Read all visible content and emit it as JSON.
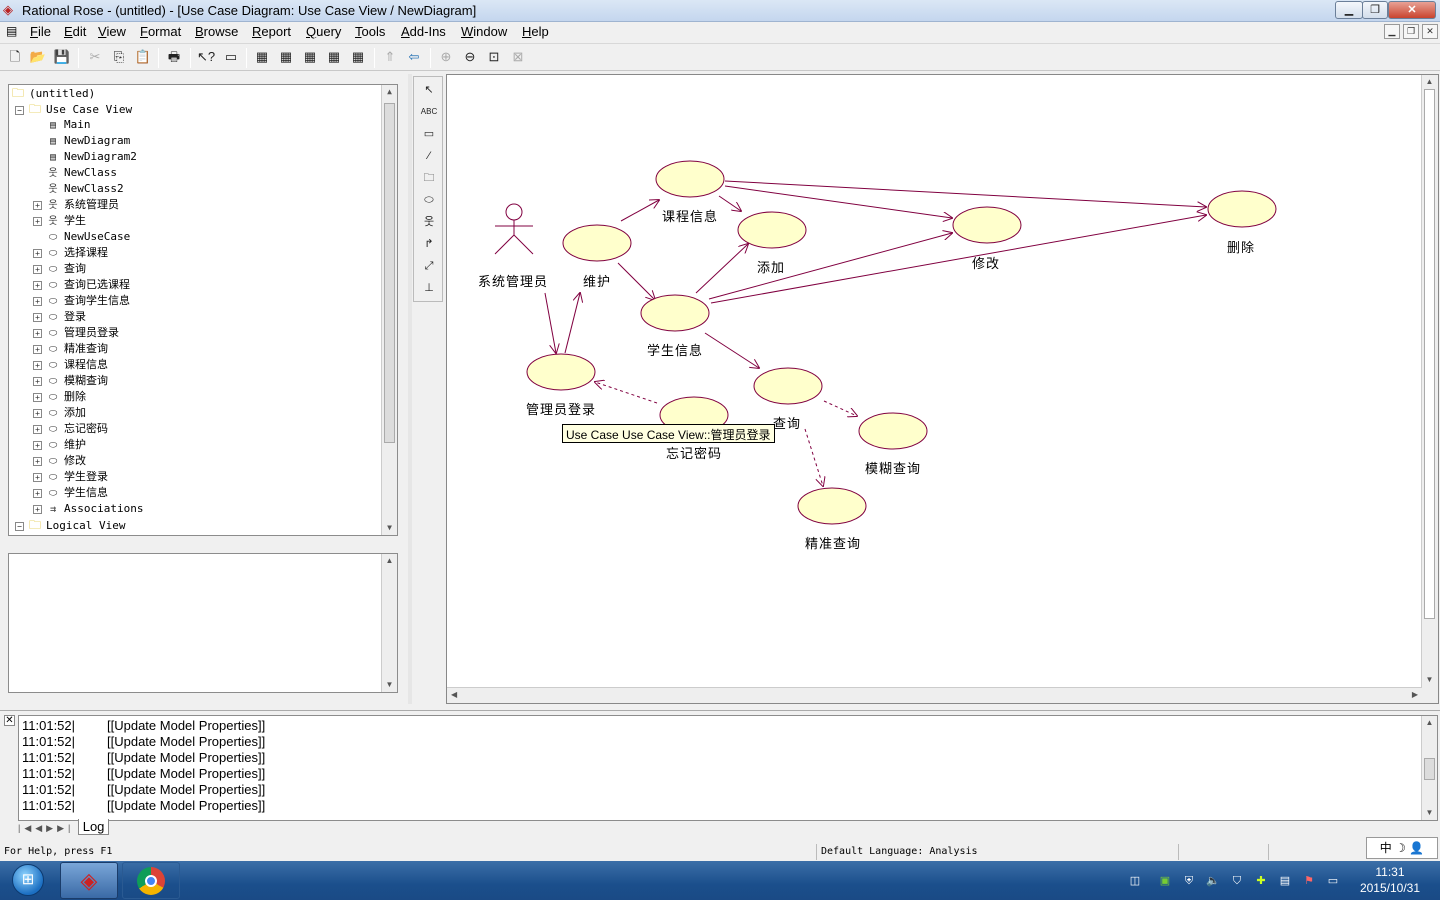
{
  "window": {
    "title": "Rational Rose - (untitled) - [Use Case Diagram: Use Case View / NewDiagram]"
  },
  "menu": [
    {
      "key": "F",
      "rest": "ile"
    },
    {
      "key": "E",
      "rest": "dit"
    },
    {
      "key": "V",
      "rest": "iew"
    },
    {
      "key": "F",
      "rest": "ormat"
    },
    {
      "key": "B",
      "rest": "rowse"
    },
    {
      "key": "R",
      "rest": "eport"
    },
    {
      "key": "Q",
      "rest": "uery"
    },
    {
      "key": "T",
      "rest": "ools"
    },
    {
      "key": "A",
      "rest": "dd-Ins"
    },
    {
      "key": "W",
      "rest": "indow"
    },
    {
      "key": "H",
      "rest": "elp"
    }
  ],
  "tree": {
    "root": "(untitled)",
    "use_case_view": "Use Case View",
    "items": [
      {
        "label": "Main",
        "icon": "diagram-icon",
        "expandable": false
      },
      {
        "label": "NewDiagram",
        "icon": "diagram-icon",
        "expandable": false
      },
      {
        "label": "NewDiagram2",
        "icon": "diagram-icon",
        "expandable": false
      },
      {
        "label": "NewClass",
        "icon": "actor-icon",
        "expandable": false
      },
      {
        "label": "NewClass2",
        "icon": "actor-icon",
        "expandable": false
      },
      {
        "label": "系统管理员",
        "icon": "actor-icon",
        "expandable": true
      },
      {
        "label": "学生",
        "icon": "actor-icon",
        "expandable": true
      },
      {
        "label": "NewUseCase",
        "icon": "usecase-icon",
        "expandable": false
      },
      {
        "label": "选择课程",
        "icon": "usecase-icon",
        "expandable": true
      },
      {
        "label": "查询",
        "icon": "usecase-icon",
        "expandable": true
      },
      {
        "label": "查询已选课程",
        "icon": "usecase-icon",
        "expandable": true
      },
      {
        "label": "查询学生信息",
        "icon": "usecase-icon",
        "expandable": true
      },
      {
        "label": "登录",
        "icon": "usecase-icon",
        "expandable": true
      },
      {
        "label": "管理员登录",
        "icon": "usecase-icon",
        "expandable": true
      },
      {
        "label": "精准查询",
        "icon": "usecase-icon",
        "expandable": true
      },
      {
        "label": "课程信息",
        "icon": "usecase-icon",
        "expandable": true
      },
      {
        "label": "模糊查询",
        "icon": "usecase-icon",
        "expandable": true
      },
      {
        "label": "删除",
        "icon": "usecase-icon",
        "expandable": true
      },
      {
        "label": "添加",
        "icon": "usecase-icon",
        "expandable": true
      },
      {
        "label": "忘记密码",
        "icon": "usecase-icon",
        "expandable": true
      },
      {
        "label": "维护",
        "icon": "usecase-icon",
        "expandable": true
      },
      {
        "label": "修改",
        "icon": "usecase-icon",
        "expandable": true
      },
      {
        "label": "学生登录",
        "icon": "usecase-icon",
        "expandable": true
      },
      {
        "label": "学生信息",
        "icon": "usecase-icon",
        "expandable": true
      },
      {
        "label": "Associations",
        "icon": "association-icon",
        "expandable": true
      }
    ],
    "logical_view": "Logical View"
  },
  "diagram": {
    "actor_label": "系统管理员",
    "usecases": {
      "kecheng": "课程信息",
      "tianjia": "添加",
      "xiugai": "修改",
      "shanchu": "删除",
      "weihu": "维护",
      "xuesheng": "学生信息",
      "guanli": "管理员登录",
      "wangji": "忘记密码",
      "chaxun": "查询",
      "mohu": "模糊查询",
      "jingzhun": "精准查询"
    },
    "tooltip": "Use Case Use Case View::管理员登录"
  },
  "colors": {
    "usecase_fill": "#ffffcc",
    "line": "#800040"
  },
  "log": {
    "rows": [
      {
        "time": "11:01:52|",
        "msg": "[[Update Model Properties]]"
      },
      {
        "time": "11:01:52|",
        "msg": "[[Update Model Properties]]"
      },
      {
        "time": "11:01:52|",
        "msg": "[[Update Model Properties]]"
      },
      {
        "time": "11:01:52|",
        "msg": "[[Update Model Properties]]"
      },
      {
        "time": "11:01:52|",
        "msg": "[[Update Model Properties]]"
      },
      {
        "time": "11:01:52|",
        "msg": "[[Update Model Properties]]"
      }
    ],
    "tab": "Log"
  },
  "status": {
    "help": "For Help, press F1",
    "language": "Default Language: Analysis"
  },
  "ime": {
    "lang": "中"
  },
  "clock": {
    "time": "11:31",
    "date": "2015/10/31"
  }
}
